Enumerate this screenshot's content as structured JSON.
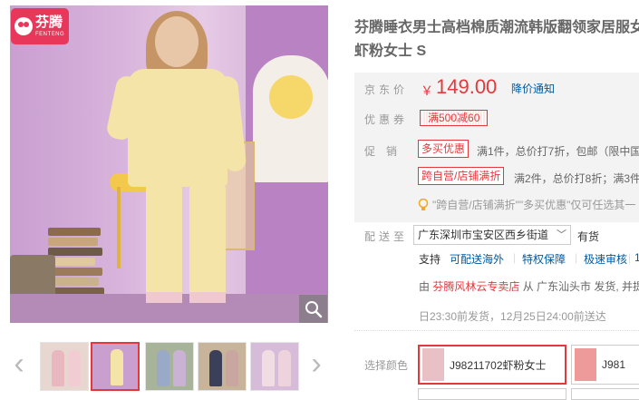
{
  "brand": {
    "name_cn": "芬腾",
    "name_en": "FENTENG"
  },
  "gallery": {
    "main_image_alt": "",
    "thumbnail_count": 5,
    "active_thumbnail": 1
  },
  "product": {
    "title_line1": "芬腾睡衣男士高档棉质潮流韩版翻领家居服女",
    "title_line2": "虾粉女士 S"
  },
  "price": {
    "label": "京东价",
    "currency": "￥",
    "value": "149.00",
    "notify_label": "降价通知"
  },
  "coupon": {
    "label": "优惠券",
    "text": "满500减60"
  },
  "promotions": {
    "label": "促　销",
    "items": [
      {
        "tag": "多买优惠",
        "text": "满1件，总价打7折，包邮（限中国"
      },
      {
        "tag": "跨自营/店铺满折",
        "text": "满2件，总价打8折；满3件"
      }
    ],
    "tip": "\"跨自营/店铺满折\"\"多买优惠\"仅可任选其一"
  },
  "delivery": {
    "label": "配送至",
    "address": "广东深圳市宝安区西乡街道",
    "stock": "有货",
    "services_label": "支持",
    "services": [
      "可配送海外",
      "特权保障",
      "极速审核",
      "1"
    ],
    "ship_prefix": "由",
    "shop": "芬腾风林云专卖店",
    "ship_suffix": "从 广东汕头市 发货, 并提",
    "deliver_text": "日23:30前发货，12月25日24:00前送达"
  },
  "colors": {
    "label": "选择颜色",
    "options": [
      {
        "name": "J98211702虾粉女士",
        "selected": true
      },
      {
        "name": "J981",
        "selected": false
      }
    ]
  },
  "colors_palette": {
    "accent": "#e4393c",
    "link": "#005aa0",
    "brand": "#e8375a"
  }
}
